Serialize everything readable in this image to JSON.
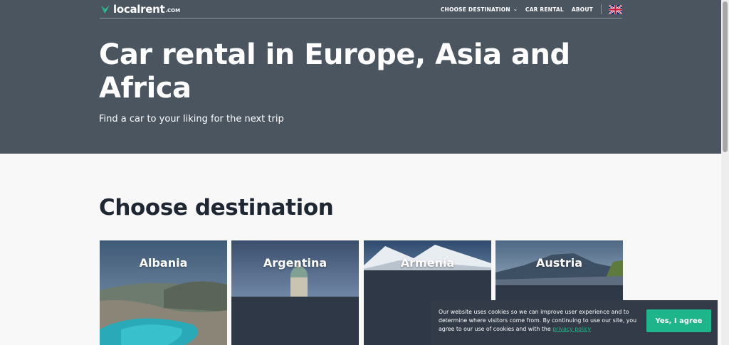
{
  "brand": {
    "name": "localrent",
    "suffix": ".COM",
    "accent": "#1fb58a"
  },
  "nav": {
    "destination_label": "CHOOSE DESTINATION",
    "car_rental_label": "CAR RENTAL",
    "about_label": "ABOUT",
    "language_icon": "uk-flag-icon"
  },
  "hero": {
    "title": "Car rental in Europe, Asia and Africa",
    "subtitle": "Find a car to your liking for the next trip",
    "background": "#4a5560"
  },
  "destinations": {
    "heading": "Choose destination",
    "cards": [
      {
        "label": "Albania"
      },
      {
        "label": "Argentina"
      },
      {
        "label": "Armenia"
      },
      {
        "label": "Austria"
      }
    ]
  },
  "cookie": {
    "text": "Our website uses cookies so we can improve user experience and to determine where visitors come from. By continuing to use our site, you agree to our use of cookies and with the",
    "link_label": "privacy policy",
    "button_label": "Yes, I agree"
  }
}
